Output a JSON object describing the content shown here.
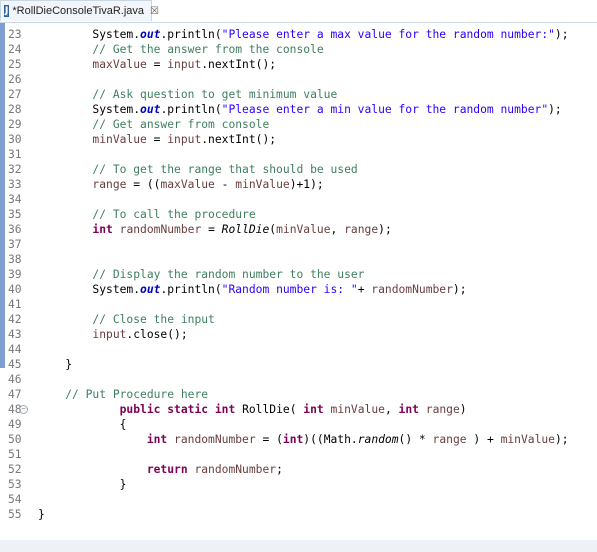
{
  "tab": {
    "icon": "J",
    "title": "*RollDieConsoleTivaR.java",
    "close": "☒"
  },
  "lines": [
    {
      "n": "23",
      "toks": [
        {
          "t": "        System."
        },
        {
          "t": "out",
          "c": "fld"
        },
        {
          "t": ".println("
        },
        {
          "t": "\"Please enter a max value for the random number:\"",
          "c": "str"
        },
        {
          "t": ");"
        }
      ]
    },
    {
      "n": "24",
      "toks": [
        {
          "t": "        "
        },
        {
          "t": "// Get the answer from the console",
          "c": "cm"
        }
      ]
    },
    {
      "n": "25",
      "toks": [
        {
          "t": "        maxValue",
          "c": "var"
        },
        {
          "t": " = "
        },
        {
          "t": "input",
          "c": "var"
        },
        {
          "t": ".nextInt();"
        }
      ]
    },
    {
      "n": "26",
      "toks": []
    },
    {
      "n": "27",
      "toks": [
        {
          "t": "        "
        },
        {
          "t": "// Ask question to get minimum value",
          "c": "cm"
        }
      ]
    },
    {
      "n": "28",
      "toks": [
        {
          "t": "        System."
        },
        {
          "t": "out",
          "c": "fld"
        },
        {
          "t": ".println("
        },
        {
          "t": "\"Please enter a min value for the random number\"",
          "c": "str"
        },
        {
          "t": ");"
        }
      ]
    },
    {
      "n": "29",
      "toks": [
        {
          "t": "        "
        },
        {
          "t": "// Get answer from console",
          "c": "cm"
        }
      ]
    },
    {
      "n": "30",
      "toks": [
        {
          "t": "        minValue",
          "c": "var"
        },
        {
          "t": " = "
        },
        {
          "t": "input",
          "c": "var"
        },
        {
          "t": ".nextInt();"
        }
      ]
    },
    {
      "n": "31",
      "toks": []
    },
    {
      "n": "32",
      "toks": [
        {
          "t": "        "
        },
        {
          "t": "// To get the range that should be used",
          "c": "cm"
        }
      ]
    },
    {
      "n": "33",
      "toks": [
        {
          "t": "        range",
          "c": "var"
        },
        {
          "t": " = (("
        },
        {
          "t": "maxValue",
          "c": "var"
        },
        {
          "t": " - "
        },
        {
          "t": "minValue",
          "c": "var"
        },
        {
          "t": ")+1);"
        }
      ]
    },
    {
      "n": "34",
      "toks": []
    },
    {
      "n": "35",
      "toks": [
        {
          "t": "        "
        },
        {
          "t": "// To call the procedure",
          "c": "cm"
        }
      ]
    },
    {
      "n": "36",
      "toks": [
        {
          "t": "        "
        },
        {
          "t": "int",
          "c": "kw"
        },
        {
          "t": " "
        },
        {
          "t": "randomNumber",
          "c": "var"
        },
        {
          "t": " = "
        },
        {
          "t": "RollDie",
          "c": "mi"
        },
        {
          "t": "("
        },
        {
          "t": "minValue",
          "c": "var"
        },
        {
          "t": ", "
        },
        {
          "t": "range",
          "c": "var"
        },
        {
          "t": ");"
        }
      ]
    },
    {
      "n": "37",
      "toks": []
    },
    {
      "n": "38",
      "toks": []
    },
    {
      "n": "39",
      "toks": [
        {
          "t": "        "
        },
        {
          "t": "// Display the random number to the user",
          "c": "cm"
        }
      ]
    },
    {
      "n": "40",
      "toks": [
        {
          "t": "        System."
        },
        {
          "t": "out",
          "c": "fld"
        },
        {
          "t": ".println("
        },
        {
          "t": "\"Random number is: \"",
          "c": "str"
        },
        {
          "t": "+ "
        },
        {
          "t": "randomNumber",
          "c": "var"
        },
        {
          "t": ");"
        }
      ]
    },
    {
      "n": "41",
      "toks": []
    },
    {
      "n": "42",
      "toks": [
        {
          "t": "        "
        },
        {
          "t": "// Close the input",
          "c": "cm"
        }
      ]
    },
    {
      "n": "43",
      "toks": [
        {
          "t": "        input",
          "c": "var"
        },
        {
          "t": ".close();"
        }
      ]
    },
    {
      "n": "44",
      "toks": []
    },
    {
      "n": "45",
      "toks": [
        {
          "t": "    }"
        }
      ]
    },
    {
      "n": "46",
      "toks": []
    },
    {
      "n": "47",
      "toks": [
        {
          "t": "    "
        },
        {
          "t": "// Put Procedure here",
          "c": "cm"
        }
      ]
    },
    {
      "n": "48",
      "fold": true,
      "toks": [
        {
          "t": "            "
        },
        {
          "t": "public",
          "c": "kw"
        },
        {
          "t": " "
        },
        {
          "t": "static",
          "c": "kw"
        },
        {
          "t": " "
        },
        {
          "t": "int",
          "c": "kw"
        },
        {
          "t": " RollDie( "
        },
        {
          "t": "int",
          "c": "kw"
        },
        {
          "t": " "
        },
        {
          "t": "minValue",
          "c": "var"
        },
        {
          "t": ", "
        },
        {
          "t": "int",
          "c": "kw"
        },
        {
          "t": " "
        },
        {
          "t": "range",
          "c": "var"
        },
        {
          "t": ")"
        }
      ]
    },
    {
      "n": "49",
      "toks": [
        {
          "t": "            {"
        }
      ]
    },
    {
      "n": "50",
      "toks": [
        {
          "t": "                "
        },
        {
          "t": "int",
          "c": "kw"
        },
        {
          "t": " "
        },
        {
          "t": "randomNumber",
          "c": "var"
        },
        {
          "t": " = ("
        },
        {
          "t": "int",
          "c": "kw"
        },
        {
          "t": ")((Math."
        },
        {
          "t": "random",
          "c": "mi"
        },
        {
          "t": "() * "
        },
        {
          "t": "range",
          "c": "var"
        },
        {
          "t": " ) + "
        },
        {
          "t": "minValue",
          "c": "var"
        },
        {
          "t": ");"
        }
      ]
    },
    {
      "n": "51",
      "toks": []
    },
    {
      "n": "52",
      "toks": [
        {
          "t": "                "
        },
        {
          "t": "return",
          "c": "kw"
        },
        {
          "t": " "
        },
        {
          "t": "randomNumber",
          "c": "var"
        },
        {
          "t": ";"
        }
      ]
    },
    {
      "n": "53",
      "toks": [
        {
          "t": "            }"
        }
      ]
    },
    {
      "n": "54",
      "toks": []
    },
    {
      "n": "55",
      "toks": [
        {
          "t": "}"
        }
      ]
    }
  ],
  "colors": {
    "keyword": "#7f0055",
    "string": "#2a00ff",
    "comment": "#3f7f5f",
    "static_field": "#0000c0",
    "local_variable": "#6a3e3e",
    "line_number": "#787878",
    "change_bar": "#7f9fd1"
  }
}
